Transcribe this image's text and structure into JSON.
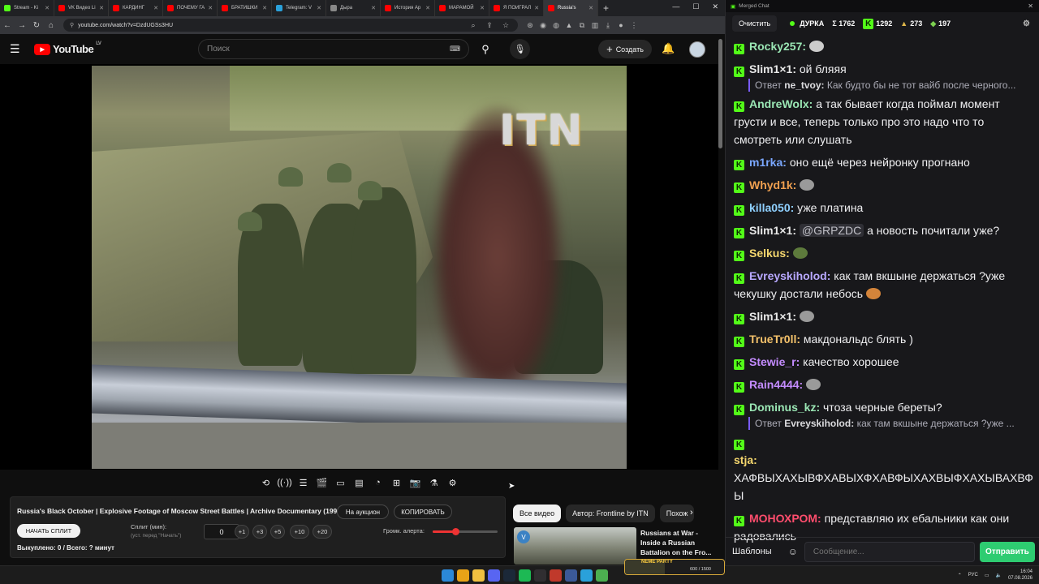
{
  "browser": {
    "tabs": [
      {
        "label": "Stream - Ki",
        "color": "#53fc18",
        "icon": "kick-icon"
      },
      {
        "label": "VK Видео Li",
        "color": "#ff0000",
        "icon": "youtube-icon"
      },
      {
        "label": "КАРДИНГ",
        "color": "#ff0000",
        "icon": "youtube-icon"
      },
      {
        "label": "ПОЧЕМУ ГА",
        "color": "#ff0000",
        "icon": "youtube-icon"
      },
      {
        "label": "БРАТИШКИ",
        "color": "#ff0000",
        "icon": "youtube-icon"
      },
      {
        "label": "Telegram: V",
        "color": "#2aa1da",
        "icon": "telegram-icon"
      },
      {
        "label": "Дыра",
        "color": "#888888",
        "icon": "page-icon"
      },
      {
        "label": "История Ар",
        "color": "#ff0000",
        "icon": "youtube-icon"
      },
      {
        "label": "МАРАМОЙ",
        "color": "#ff0000",
        "icon": "youtube-icon"
      },
      {
        "label": "Я ПОИГРАЛ",
        "color": "#ff0000",
        "icon": "youtube-icon"
      },
      {
        "label": "Russia's",
        "color": "#ff0000",
        "icon": "youtube-icon",
        "active": true
      }
    ],
    "url": "youtube.com/watch?v=DzdUGSs3HU"
  },
  "youtube": {
    "logo_text": "YouTube",
    "region": "LV",
    "search_placeholder": "Поиск",
    "create_label": "Создать"
  },
  "video": {
    "watermark": "ITN"
  },
  "player_controls": [
    {
      "name": "loop-icon",
      "glyph": "⟲"
    },
    {
      "name": "broadcast-icon",
      "glyph": "((·))"
    },
    {
      "name": "playlist-add-icon",
      "glyph": "☰"
    },
    {
      "name": "clapper-icon",
      "glyph": "🎬"
    },
    {
      "name": "picture-in-picture-icon",
      "glyph": "▭"
    },
    {
      "name": "theater-icon",
      "glyph": "▤"
    },
    {
      "name": "speed-icon",
      "glyph": "◔"
    },
    {
      "name": "add-clip-icon",
      "glyph": "⊞"
    },
    {
      "name": "screenshot-icon",
      "glyph": "📷"
    },
    {
      "name": "lab-icon",
      "glyph": "⚗"
    },
    {
      "name": "gear-icon",
      "glyph": "⚙"
    }
  ],
  "info": {
    "title": "Russia's Black October | Explosive Footage of Moscow Street Battles | Archive Documentary (1993)",
    "auction_label": "На аукцион",
    "copy_label": "КОПИРОВАТЬ",
    "start_split_label": "НАЧАТЬ СПЛИТ",
    "split_label": "Сплит (мин):",
    "split_hint": "(уст. перед \"Начать\")",
    "split_value": "0",
    "increments": [
      "+1",
      "+3",
      "+5",
      "+10",
      "+20"
    ],
    "alert_label": "Громк. алерта:",
    "alert_volume": 0.35,
    "bought_text": "Выкуплено: 0 / Всего: ? минут"
  },
  "chips": [
    "Все видео",
    "Автор: Frontline by ITN",
    "Похож"
  ],
  "recommendation": {
    "title": "Russians at War - Inside a Russian Battalion on the Fro..."
  },
  "neme": {
    "label": "NEME PARTY",
    "value_text": "600 / 1500",
    "progress": 0.4
  },
  "taskbar": {
    "apps": [
      {
        "name": "windows-start-icon",
        "color": "#2b88d8"
      },
      {
        "name": "chrome-icon",
        "color": "#e8a317"
      },
      {
        "name": "files-icon",
        "color": "#f0c040"
      },
      {
        "name": "discord-icon",
        "color": "#5865f2"
      },
      {
        "name": "steam-icon",
        "color": "#1b2838"
      },
      {
        "name": "spotify-icon",
        "color": "#1db954"
      },
      {
        "name": "obs-icon",
        "color": "#302e31"
      },
      {
        "name": "app-red-icon",
        "color": "#c0392b"
      },
      {
        "name": "app-blue-icon",
        "color": "#3b5998"
      },
      {
        "name": "telegram-icon",
        "color": "#2aa1da"
      },
      {
        "name": "app-green-icon",
        "color": "#4caf50"
      }
    ],
    "lang": "РУС",
    "time": "16:04",
    "date": "07.08.2026"
  },
  "chat": {
    "window_title": "Merged Chat",
    "clear_label": "Очистить",
    "channel": "ДУРКА",
    "total": "Σ 1762",
    "kick_count": "1292",
    "stat2": "273",
    "stat3": "197",
    "input_placeholder": "Сообщение...",
    "templates_label": "Шаблоны",
    "send_label": "Отправить",
    "messages": [
      {
        "user": "Rocky257:",
        "color": "#9ae6b4",
        "text": "",
        "emote": "#cccccc"
      },
      {
        "user": "Slim1×1:",
        "color": "#e8e8e8",
        "text": "ой бляяя"
      },
      {
        "reply_user": "ne_tvoy:",
        "reply_text": "Как будто бы не тот вайб после черного..."
      },
      {
        "user": "AndreWolx:",
        "color": "#9ae6b4",
        "text": "а так бывает когда поймал момент грусти и все, теперь только про это надо что то смотреть или слушать"
      },
      {
        "user": "m1rka:",
        "color": "#7aa7ff",
        "text": "оно ещё через нейронку прогнано"
      },
      {
        "user": "Whyd1k:",
        "color": "#f0a050",
        "text": "",
        "emote": "#9a9a9a"
      },
      {
        "user": "killa050:",
        "color": "#8fd0ff",
        "text": "уже платина"
      },
      {
        "user": "Slim1×1:",
        "color": "#e8e8e8",
        "mention": "@GRPZDC",
        "text": "а новость почитали уже?"
      },
      {
        "user": "Selkus:",
        "color": "#f5d76e",
        "text": "",
        "emote": "#5d7a3c"
      },
      {
        "user": "Evreyskiholod:",
        "color": "#b8a8ff",
        "text": "как там вкшыне держаться ?уже чекушку достали небось",
        "emote": "#d4843a"
      },
      {
        "user": "Slim1×1:",
        "color": "#e8e8e8",
        "text": "",
        "emote": "#9a9a9a"
      },
      {
        "user": "TrueTr0ll:",
        "color": "#f5c26b",
        "text": "макдональдс блять )"
      },
      {
        "user": "Stewie_r:",
        "color": "#c48cff",
        "text": "качество хорошее"
      },
      {
        "user": "Rain4444:",
        "color": "#c48cff",
        "text": "",
        "emote": "#9a9a9a"
      },
      {
        "user": "Dominus_kz:",
        "color": "#9ae6b4",
        "text": "чтоза черные береты?"
      },
      {
        "reply_user": "Evreyskiholod:",
        "reply_text": "как там вкшыне держаться ?уже ..."
      },
      {
        "user": "stja:",
        "color": "#f5d76e",
        "text": "ХАФВЫХАХЫВФХАВЫХФХАВФЫХАХВЫФХАХЫВАХВФЫ",
        "break": true
      },
      {
        "user": "МОНОХРОМ:",
        "color": "#ff4d6d",
        "text": "представляю их ебальники  как они радовались"
      }
    ]
  }
}
